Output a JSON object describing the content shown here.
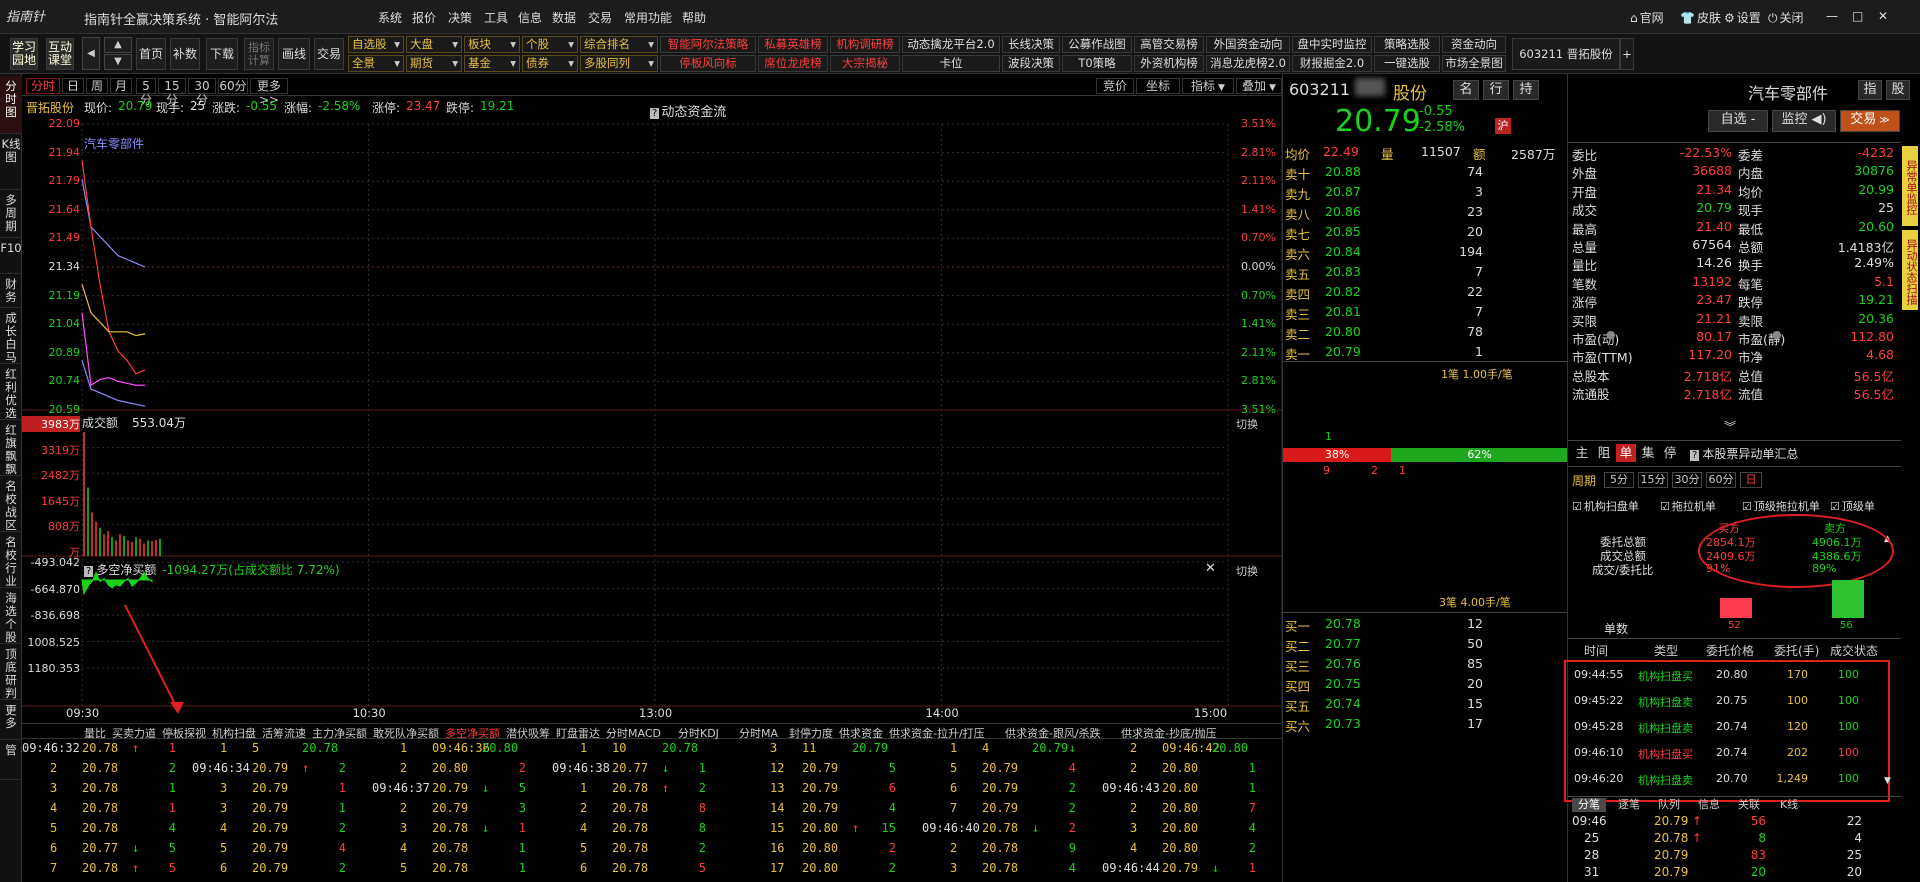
{
  "app": {
    "logo": "指南针",
    "title": "指南针全赢决策系统 · 智能阿尔法",
    "menu": [
      "系统",
      "报价",
      "决策",
      "工具",
      "信息",
      "数据",
      "交易",
      "常用功能",
      "帮助"
    ],
    "top_right": [
      "官网",
      "皮肤",
      "设置",
      "关闭"
    ],
    "window_controls": [
      "—",
      "□",
      "✕"
    ]
  },
  "toolbar": {
    "buttons": [
      "学习园地",
      "互动课堂",
      "首页",
      "补数",
      "下载",
      "指标计算",
      "画线",
      "交易"
    ],
    "row1": [
      {
        "label": "自选股",
        "type": "dd"
      },
      {
        "label": "大盘",
        "type": "dd"
      },
      {
        "label": "板块",
        "type": "dd"
      },
      {
        "label": "个股",
        "type": "dd"
      },
      {
        "label": "综合排名",
        "type": "dd"
      },
      {
        "label": "智能阿尔法策略",
        "type": "red"
      },
      {
        "label": "私募英雄榜",
        "type": "red"
      },
      {
        "label": "机构调研榜",
        "type": "red"
      },
      {
        "label": "动态擒龙平台2.0",
        "type": "wht"
      },
      {
        "label": "长线决策",
        "type": "wht"
      },
      {
        "label": "公募作战图",
        "type": "wht"
      },
      {
        "label": "高管交易榜",
        "type": "wht"
      },
      {
        "label": "外国资金动向",
        "type": "wht"
      },
      {
        "label": "盘中实时监控",
        "type": "wht"
      },
      {
        "label": "策略选股",
        "type": "wht"
      },
      {
        "label": "资金动向",
        "type": "wht"
      }
    ],
    "row2": [
      {
        "label": "全景",
        "type": "dd"
      },
      {
        "label": "期货",
        "type": "dd"
      },
      {
        "label": "基金",
        "type": "dd"
      },
      {
        "label": "债券",
        "type": "dd"
      },
      {
        "label": "多股同列",
        "type": "dd"
      },
      {
        "label": "停板风向标",
        "type": "red"
      },
      {
        "label": "席位龙虎榜",
        "type": "red"
      },
      {
        "label": "大宗揭秘",
        "type": "red"
      },
      {
        "label": "卡位",
        "type": "wht"
      },
      {
        "label": "波段决策",
        "type": "wht"
      },
      {
        "label": "T0策略",
        "type": "wht"
      },
      {
        "label": "外资机构榜",
        "type": "wht"
      },
      {
        "label": "消息龙虎榜2.0",
        "type": "wht"
      },
      {
        "label": "财报掘金2.0",
        "type": "wht"
      },
      {
        "label": "一键选股",
        "type": "wht"
      },
      {
        "label": "市场全景图",
        "type": "wht"
      }
    ],
    "stock_tab": "603211 晋拓股份",
    "add_tab": "+"
  },
  "sidebar": [
    "分时图",
    "K线图",
    "多周期",
    "F10",
    "财务",
    "成长白马",
    "红利优选",
    "红旗飘飘",
    "名校战区",
    "名校行业",
    "海选个股",
    "顶底研判",
    "更多",
    "管"
  ],
  "periods": [
    "分时",
    "日",
    "周",
    "月",
    "5分",
    "15分",
    "30分",
    "60分",
    "更多>>"
  ],
  "chart_tools": [
    "竞价",
    "坐标",
    "指标",
    "叠加"
  ],
  "info": {
    "name": "晋拓股份",
    "price_label": "现价:",
    "price": "20.79",
    "hand_label": "现手:",
    "hand": "25",
    "chg_label": "涨跌:",
    "chg": "-0.55",
    "pct_label": "涨幅:",
    "pct": "-2.58%",
    "limit_up_label": "涨停:",
    "limit_up": "23.47",
    "limit_down_label": "跌停:",
    "limit_down": "19.21",
    "flow_link": "动态资金流"
  },
  "chart_data": [
    {
      "type": "line",
      "title": "",
      "overlay_label": "汽车零部件",
      "y_ticks": [
        "22.09",
        "21.94",
        "21.79",
        "21.64",
        "21.49",
        "21.34",
        "21.19",
        "21.04",
        "20.89",
        "20.74",
        "20.59"
      ],
      "pct_ticks": [
        "3.51%",
        "2.81%",
        "2.11%",
        "1.41%",
        "0.70%",
        "0.00%",
        "0.70%",
        "1.41%",
        "2.11%",
        "2.81%",
        "3.51%"
      ],
      "ylim": [
        20.59,
        22.09
      ],
      "x_ticks": [
        "09:30",
        "10:30",
        "13:00",
        "14:00",
        "15:00"
      ],
      "series": [
        {
          "name": "汽车零部件",
          "color": "#8c8cff",
          "values": [
            21.8,
            21.55,
            21.5,
            21.45,
            21.4,
            21.38,
            21.36,
            21.34
          ]
        },
        {
          "color": "#ff3c3c",
          "values": [
            21.9,
            21.55,
            21.25,
            21.0,
            20.9,
            20.85,
            20.78,
            20.8
          ]
        },
        {
          "color": "#e8c040",
          "values": [
            21.25,
            21.1,
            21.05,
            21.0,
            21.0,
            21.0,
            20.98,
            20.99
          ]
        },
        {
          "color": "#ff4fff",
          "values": [
            21.1,
            20.72,
            20.75,
            20.76,
            20.74,
            20.73,
            20.72,
            20.72
          ]
        },
        {
          "color": "#8c8cff",
          "values": [
            20.85,
            20.7,
            20.68,
            20.66,
            20.64,
            20.63,
            20.62,
            20.61
          ]
        }
      ]
    },
    {
      "type": "bar",
      "title": "成交额",
      "value_label": "553.04万",
      "y_ticks": [
        "3983万",
        "3319万",
        "2482万",
        "1645万",
        "808万",
        "万"
      ],
      "ylim": [
        0,
        3983
      ],
      "values": [
        3983,
        2200,
        1400,
        1100,
        900,
        700,
        800,
        600,
        500,
        700,
        650,
        500,
        450,
        600,
        550,
        400,
        500,
        480,
        520,
        553
      ]
    },
    {
      "type": "area",
      "title": "多空净买额",
      "value_label": "-1094.27万(占成交额比 7.72%)",
      "y_ticks": [
        "-493.042",
        "-664.870",
        "-836.698",
        "1008.525",
        "1180.353"
      ],
      "ylim": [
        -1180,
        -493
      ],
      "values": [
        -700,
        -650,
        -620,
        -560,
        -620,
        -600,
        -640,
        -660,
        -640,
        -650,
        -620,
        -600,
        -650,
        -630,
        -600,
        -560,
        -600,
        -620
      ]
    }
  ],
  "switch_label": "切换",
  "bottom_tabs": [
    "量比",
    "买卖力道",
    "停板探视",
    "机构扫盘",
    "活筹流速",
    "主力净买额",
    "敢死队净买额",
    "多空净买额",
    "潜伏吸筹",
    "盯盘雷达",
    "分时MACD",
    "分时KDJ",
    "分时MA",
    "封停力度",
    "供求资金",
    "供求资金-拉升/打压",
    "供求资金-跟风/杀跌",
    "供求资金-抄底/抛压"
  ],
  "bottom_ticks": [
    [
      "09:46:32",
      "20.78",
      "↑",
      "1",
      "1",
      "5",
      "20.78",
      "",
      "1",
      "09:46:36",
      "20.80",
      "",
      "1",
      "10",
      "20.78",
      "",
      "3",
      "11",
      "20.79",
      "",
      "1",
      "4",
      "20.79",
      "↓",
      "2",
      "09:46:42",
      "20.80",
      "",
      "1"
    ],
    [
      "2",
      "20.78",
      "",
      "2",
      "09:46:34",
      "20.79",
      "↑",
      "2",
      "2",
      "20.80",
      "",
      "2",
      "09:46:38",
      "20.77",
      "↓",
      "1",
      "12",
      "20.79",
      "",
      "5",
      "5",
      "20.79",
      "",
      "4",
      "2",
      "20.80",
      "",
      "1"
    ],
    [
      "3",
      "20.78",
      "",
      "1",
      "3",
      "20.79",
      "",
      "1",
      "09:46:37",
      "20.79",
      "↓",
      "5",
      "1",
      "20.78",
      "↑",
      "2",
      "13",
      "20.79",
      "",
      "6",
      "6",
      "20.79",
      "",
      "2",
      "09:46:43",
      "20.80",
      "",
      "1"
    ],
    [
      "4",
      "20.78",
      "",
      "1",
      "3",
      "20.79",
      "",
      "1",
      "2",
      "20.79",
      "",
      "3",
      "2",
      "20.78",
      "",
      "8",
      "14",
      "20.79",
      "",
      "4",
      "7",
      "20.79",
      "",
      "2",
      "2",
      "20.80",
      "",
      "7"
    ],
    [
      "5",
      "20.78",
      "",
      "4",
      "4",
      "20.79",
      "",
      "2",
      "3",
      "20.78",
      "↓",
      "1",
      "4",
      "20.78",
      "",
      "8",
      "15",
      "20.80",
      "↑",
      "15",
      "09:46:40",
      "20.78",
      "↓",
      "2",
      "3",
      "20.80",
      "",
      "4"
    ],
    [
      "6",
      "20.77",
      "↓",
      "5",
      "5",
      "20.79",
      "",
      "4",
      "4",
      "20.78",
      "",
      "1",
      "5",
      "20.78",
      "",
      "2",
      "16",
      "20.80",
      "",
      "2",
      "2",
      "20.78",
      "",
      "9",
      "4",
      "20.80",
      "",
      "2"
    ],
    [
      "7",
      "20.78",
      "↑",
      "5",
      "6",
      "20.79",
      "",
      "2",
      "5",
      "20.78",
      "",
      "1",
      "6",
      "20.78",
      "",
      "5",
      "17",
      "20.80",
      "",
      "2",
      "3",
      "20.78",
      "",
      "4",
      "09:46:44",
      "20.79",
      "↓",
      "1"
    ]
  ],
  "orderbook": {
    "code_label": "603211",
    "name_label": "晋拓股份",
    "price": "20.79",
    "chg": "-0.55",
    "pct": "-2.58%",
    "tag": "沪",
    "top": {
      "avg_label": "均价",
      "avg": "22.49",
      "vol_label": "量",
      "vol": "11507",
      "amt_label": "额",
      "amt": "2587万"
    },
    "asks": [
      [
        "卖十",
        "20.88",
        "74"
      ],
      [
        "卖九",
        "20.87",
        "3"
      ],
      [
        "卖八",
        "20.86",
        "23"
      ],
      [
        "卖七",
        "20.85",
        "20"
      ],
      [
        "卖六",
        "20.84",
        "194"
      ],
      [
        "卖五",
        "20.83",
        "7"
      ],
      [
        "卖四",
        "20.82",
        "22"
      ],
      [
        "卖三",
        "20.81",
        "7"
      ],
      [
        "卖二",
        "20.80",
        "78"
      ],
      [
        "卖一",
        "20.79",
        "1"
      ]
    ],
    "ask_note": "1笔 1.00手/笔",
    "bid_note": "3笔 4.00手/笔",
    "bar_small": "1",
    "bar_left": "38%",
    "bar_right": "62%",
    "bar_left_frac": 0.38,
    "bar_counts": [
      "9",
      "2",
      "1"
    ],
    "bids": [
      [
        "买一",
        "20.78",
        "12"
      ],
      [
        "买二",
        "20.77",
        "50"
      ],
      [
        "买三",
        "20.76",
        "85"
      ],
      [
        "买四",
        "20.75",
        "20"
      ],
      [
        "买五",
        "20.74",
        "15"
      ],
      [
        "买六",
        "20.73",
        "17"
      ]
    ]
  },
  "right": {
    "industry": "汽车零部件",
    "btns": [
      "指",
      "股"
    ],
    "name_tabs": [
      "名",
      "行",
      "持"
    ],
    "actions": [
      "自选 -",
      "监控",
      "交易"
    ],
    "stats": [
      [
        "委比",
        "-22.53%",
        "red",
        "委差",
        "-4232",
        "red"
      ],
      [
        "外盘",
        "36688",
        "red",
        "内盘",
        "30876",
        "grn"
      ],
      [
        "开盘",
        "21.34",
        "red",
        "均价",
        "20.99",
        "grn"
      ],
      [
        "成交",
        "20.79",
        "grn",
        "现手",
        "25",
        "wht"
      ],
      [
        "最高",
        "21.40",
        "red",
        "最低",
        "20.60",
        "grn"
      ],
      [
        "总量",
        "67564",
        "wht",
        "总额",
        "1.4183亿",
        "wht"
      ],
      [
        "量比",
        "14.26",
        "wht",
        "换手",
        "2.49%",
        "wht"
      ],
      [
        "笔数",
        "13192",
        "red",
        "每笔",
        "5.1",
        "red"
      ],
      [
        "涨停",
        "23.47",
        "red",
        "跌停",
        "19.21",
        "grn"
      ],
      [
        "买限",
        "21.21",
        "red",
        "卖限",
        "20.36",
        "grn"
      ],
      [
        "市盈(动)",
        "80.17",
        "red",
        "市盈(静)",
        "112.80",
        "red"
      ],
      [
        "市盈(TTM)",
        "117.20",
        "red",
        "市净",
        "4.68",
        "red"
      ],
      [
        "总股本",
        "2.718亿",
        "red",
        "总值",
        "56.5亿",
        "red"
      ],
      [
        "流通股",
        "2.718亿",
        "red",
        "流值",
        "56.5亿",
        "red"
      ]
    ],
    "expand": "︾",
    "mode_tabs": [
      "主",
      "阻",
      "单",
      "集",
      "停"
    ],
    "summary_link": "本股票异动单汇总",
    "period_label": "周期",
    "period_tabs": [
      "5分",
      "15分",
      "30分",
      "60分",
      "日"
    ],
    "checks": [
      "机构扫盘单",
      "拖拉机单",
      "顶级拖拉机单",
      "顶级单"
    ],
    "buy_label": "买方",
    "sell_label": "卖方",
    "rows": [
      [
        "委托总额",
        "2854.1万",
        "4906.1万"
      ],
      [
        "成交总额",
        "2409.6万",
        "4386.6万"
      ],
      [
        "成交/委托比",
        "91%",
        "89%"
      ]
    ],
    "count_label": "单数",
    "buy_count": "52",
    "sell_count": "56",
    "table_headers": [
      "时间",
      "类型",
      "委托价格",
      "委托(手)",
      "成交状态"
    ],
    "table_rows": [
      [
        "09:44:55",
        "机构扫盘买",
        "20.80",
        "170",
        "100",
        "grn"
      ],
      [
        "09:45:22",
        "机构扫盘卖",
        "20.75",
        "100",
        "100",
        "grn"
      ],
      [
        "09:45:28",
        "机构扫盘卖",
        "20.74",
        "120",
        "100",
        "grn"
      ],
      [
        "09:46:10",
        "机构扫盘买",
        "20.74",
        "202",
        "100",
        "red"
      ],
      [
        "09:46:20",
        "机构扫盘卖",
        "20.70",
        "1,249",
        "100",
        "grn"
      ]
    ],
    "bottom_tabs": [
      "分笔",
      "逐笔",
      "队列",
      "信息",
      "关联",
      "K线"
    ],
    "ticks": [
      [
        "09:46",
        "20.79",
        "↑",
        "56",
        "22"
      ],
      [
        "25",
        "20.78",
        "↑",
        "8",
        "4"
      ],
      [
        "28",
        "20.79",
        "",
        "83",
        "25"
      ],
      [
        "31",
        "20.79",
        "",
        "20",
        "20"
      ]
    ]
  },
  "farright": [
    "异常单监控",
    "异动状态扫描"
  ]
}
